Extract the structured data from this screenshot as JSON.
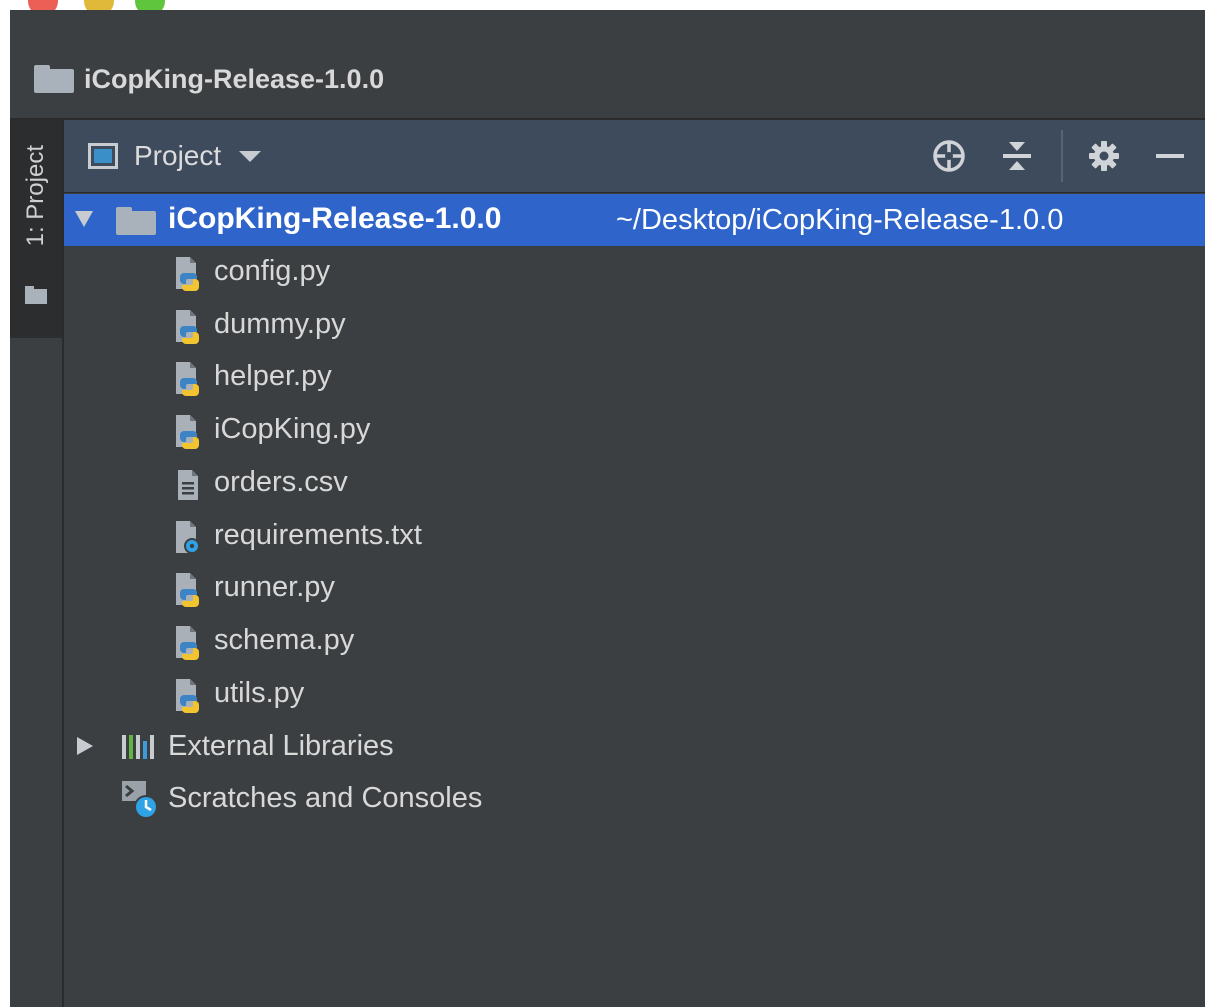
{
  "window": {
    "title": "iCopKing-Release-1.0.0",
    "controls": [
      "close",
      "minimize",
      "zoom"
    ]
  },
  "tool_strip": {
    "tab_label": "1: Project"
  },
  "panel": {
    "view_selector": "Project",
    "header_buttons": [
      "locate-icon",
      "collapse-all-icon",
      "gear-icon",
      "minimize-icon"
    ]
  },
  "tree": {
    "root": {
      "name": "iCopKing-Release-1.0.0",
      "path": "~/Desktop/iCopKing-Release-1.0.0",
      "expanded": true
    },
    "files": [
      {
        "name": "config.py",
        "type": "python"
      },
      {
        "name": "dummy.py",
        "type": "python"
      },
      {
        "name": "helper.py",
        "type": "python"
      },
      {
        "name": "iCopKing.py",
        "type": "python"
      },
      {
        "name": "orders.csv",
        "type": "text"
      },
      {
        "name": "requirements.txt",
        "type": "requirements"
      },
      {
        "name": "runner.py",
        "type": "python"
      },
      {
        "name": "schema.py",
        "type": "python"
      },
      {
        "name": "utils.py",
        "type": "python"
      }
    ],
    "external_libraries": "External Libraries",
    "scratches": "Scratches and Consoles"
  },
  "colors": {
    "background": "#3c3f41",
    "header": "#3d4b5c",
    "selection": "#2f65ca",
    "text": "#d8d8d8"
  }
}
